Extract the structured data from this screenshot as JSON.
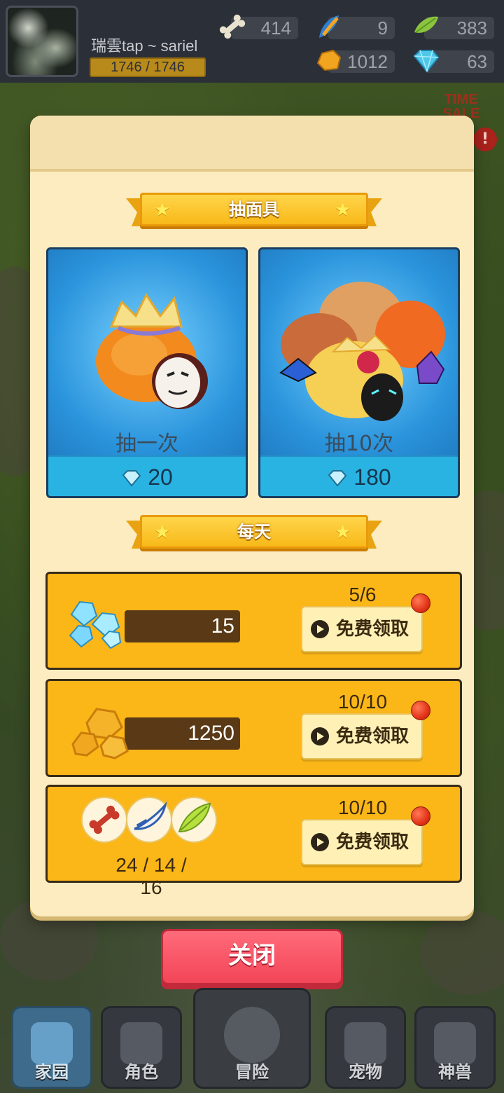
{
  "player": {
    "name": "瑞雲tap ~ sariel",
    "level_text": "1746 / 1746"
  },
  "resources": [
    {
      "name": "bone",
      "icon": "bone-icon",
      "value": "414"
    },
    {
      "name": "feather",
      "icon": "feather-icon",
      "value": "9"
    },
    {
      "name": "leaf",
      "icon": "leaf-icon",
      "value": "383"
    },
    {
      "name": "gold-ore",
      "icon": "gold-ore-icon",
      "value": "1012"
    },
    {
      "name": "gem",
      "icon": "gem-icon",
      "value": "63"
    }
  ],
  "side": {
    "time_sale_line1": "TIME",
    "time_sale_line2": "SALE",
    "alert": "!"
  },
  "modal": {
    "draw_title": "抽面具",
    "draw_cards": [
      {
        "label": "抽一次",
        "price": "20"
      },
      {
        "label": "抽10次",
        "price": "180"
      }
    ],
    "daily_title": "每天",
    "daily_rows": [
      {
        "reward_value": "15",
        "count": "5/6",
        "button_label": "免费领取",
        "icon": "gem-pile-icon"
      },
      {
        "reward_value": "1250",
        "count": "10/10",
        "button_label": "免费领取",
        "icon": "gold-ore-pile-icon"
      },
      {
        "reward_value": "24 / 14 / 16",
        "count": "10/10",
        "button_label": "免费领取",
        "icon": "materials-icon"
      }
    ],
    "close_label": "关闭"
  },
  "nav": [
    {
      "label": "家园",
      "icon": "home-icon",
      "active": true
    },
    {
      "label": "角色",
      "icon": "mask-icon",
      "active": false
    },
    {
      "label": "冒险",
      "icon": "paw-icon",
      "active": false
    },
    {
      "label": "宠物",
      "icon": "frog-icon",
      "active": false
    },
    {
      "label": "神兽",
      "icon": "dino-skull-icon",
      "active": false
    }
  ],
  "colors": {
    "modal_bg": "#fcecc0",
    "ribbon": "#f8b919",
    "daily_row": "#fbb618",
    "close_button": "#f24558",
    "card_blue": "#2a94dc"
  }
}
